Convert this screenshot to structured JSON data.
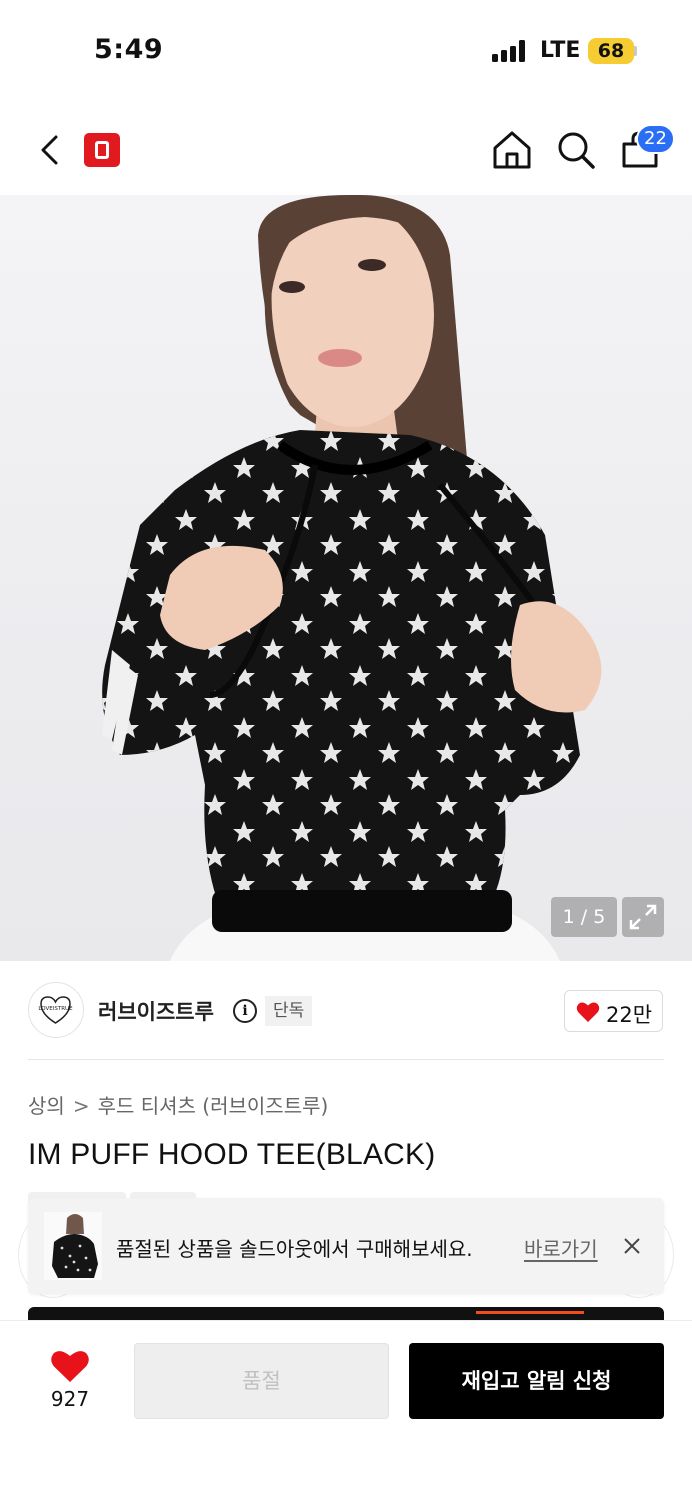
{
  "status_bar": {
    "time": "5:49",
    "network": "LTE",
    "battery": "68"
  },
  "header": {
    "logo": "O",
    "cart_count": "22",
    "icons": [
      "back-icon",
      "home-icon",
      "search-icon",
      "cart-icon"
    ]
  },
  "gallery": {
    "counter": "1 / 5",
    "icons": [
      "expand-icon"
    ]
  },
  "brand": {
    "name": "러브이즈트루",
    "exclusive_label": "단독",
    "likes": "22만",
    "logo_text": "LOVEISTRUE"
  },
  "breadcrumb": {
    "category": "상의",
    "separator": ">",
    "subcategory": "후드 티셔츠 (러브이즈트루)"
  },
  "product": {
    "title": "IM PUFF HOOD TEE(BLACK)"
  },
  "toast": {
    "message": "품절된 상품을 솔드아웃에서 구매해보세요.",
    "link_label": "바로가기"
  },
  "bottom_bar": {
    "wish_count": "927",
    "soldout_label": "품절",
    "restock_label": "재입고 알림 신청"
  },
  "colors": {
    "accent_red": "#e01a1f",
    "badge_blue": "#2a6ef5",
    "heart_red": "#e8121b",
    "battery_yellow": "#f5cd33"
  }
}
